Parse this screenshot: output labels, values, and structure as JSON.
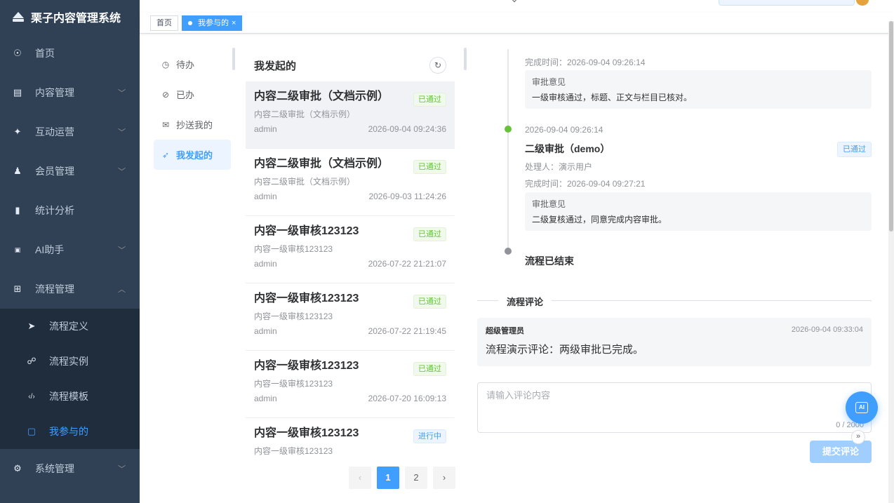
{
  "app": {
    "title": "栗子内容管理系统"
  },
  "sidebar": {
    "items": [
      {
        "label": "首页",
        "icon": "dashboard-icon",
        "arrow": ""
      },
      {
        "label": "内容管理",
        "icon": "document-icon",
        "arrow": "﹀"
      },
      {
        "label": "互动运营",
        "icon": "interaction-icon",
        "arrow": "﹀"
      },
      {
        "label": "会员管理",
        "icon": "users-icon",
        "arrow": "﹀"
      },
      {
        "label": "统计分析",
        "icon": "bar-chart-icon",
        "arrow": ""
      },
      {
        "label": "AI助手",
        "icon": "ai-icon",
        "arrow": "﹀"
      },
      {
        "label": "流程管理",
        "icon": "workflow-icon",
        "arrow": "︿"
      }
    ],
    "subitems": [
      {
        "label": "流程定义",
        "icon": "send-icon"
      },
      {
        "label": "流程实例",
        "icon": "instance-icon"
      },
      {
        "label": "流程模板",
        "icon": "code-icon"
      },
      {
        "label": "我参与的",
        "icon": "participate-icon"
      }
    ],
    "bottom": {
      "label": "系统管理",
      "icon": "settings-icon",
      "arrow": "﹀"
    }
  },
  "tags": {
    "home": "首页",
    "current": "我参与的",
    "close": "×"
  },
  "categories": [
    {
      "label": "待办",
      "icon": "clock-icon",
      "glyph": "◷"
    },
    {
      "label": "已办",
      "icon": "check-circle-icon",
      "glyph": "⊘"
    },
    {
      "label": "抄送我的",
      "icon": "mail-icon",
      "glyph": "✉"
    },
    {
      "label": "我发起的",
      "icon": "send-icon",
      "glyph": "➶"
    }
  ],
  "list": {
    "title": "我发起的",
    "items": [
      {
        "title": "内容二级审批（文档示例）",
        "sub": "内容二级审批（文档示例）",
        "user": "admin",
        "time": "2026-09-04 09:24:36",
        "status": "已通过"
      },
      {
        "title": "内容二级审批（文档示例）",
        "sub": "内容二级审批（文档示例）",
        "user": "admin",
        "time": "2026-09-03 11:24:26",
        "status": "已通过"
      },
      {
        "title": "内容一级审核123123",
        "sub": "内容一级审核123123",
        "user": "admin",
        "time": "2026-07-22 21:21:07",
        "status": "已通过"
      },
      {
        "title": "内容一级审核123123",
        "sub": "内容一级审核123123",
        "user": "admin",
        "time": "2026-07-22 21:19:45",
        "status": "已通过"
      },
      {
        "title": "内容一级审核123123",
        "sub": "内容一级审核123123",
        "user": "admin",
        "time": "2026-07-20 16:09:13",
        "status": "已通过"
      },
      {
        "title": "内容一级审核123123",
        "sub": "内容一级审核123123",
        "user": "",
        "time": "",
        "status": "进行中"
      }
    ],
    "pager": {
      "prev": "‹",
      "pages": [
        "1",
        "2"
      ],
      "next": "›",
      "current": 1
    }
  },
  "detail": {
    "node1": {
      "finish": "完成时间：2026-09-04 09:26:14",
      "opinion_label": "审批意见",
      "opinion": "一级审核通过，标题、正文与栏目已核对。"
    },
    "node2": {
      "time": "2026-09-04 09:26:14",
      "title": "二级审批（demo）",
      "status": "已通过",
      "handler": "处理人：演示用户",
      "finish": "完成时间：2026-09-04 09:27:21",
      "opinion_label": "审批意见",
      "opinion": "二级复核通过，同意完成内容审批。"
    },
    "end": "流程已结束",
    "comments_title": "流程评论",
    "comment": {
      "author": "超级管理员",
      "time": "2026-09-04 09:33:04",
      "text": "流程演示评论：两级审批已完成。"
    },
    "input": {
      "placeholder": "请输入评论内容",
      "counter": "0 / 2000"
    },
    "submit": "提交评论"
  },
  "colors": {
    "sidebar": "#304156",
    "accent": "#409eff",
    "success": "#67c23a",
    "timeline_green": "#67c23a",
    "timeline_gray": "#909399"
  }
}
